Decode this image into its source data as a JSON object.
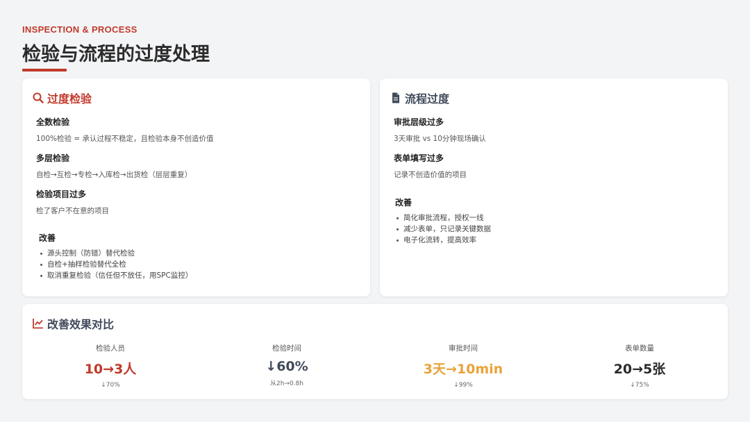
{
  "header": {
    "eyebrow": "INSPECTION & PROCESS",
    "title": "检验与流程的过度处理",
    "accent": "#c0392b"
  },
  "inspection_card": {
    "icon": "search-icon",
    "title": "过度检验",
    "items": [
      {
        "heading": "全数检验",
        "desc": "100%检验 = 承认过程不稳定，且检验本身不创造价值"
      },
      {
        "heading": "多层检验",
        "desc": "自检→互检→专检→入库检→出货检（层层重复）"
      },
      {
        "heading": "检验项目过多",
        "desc": "检了客户不在意的项目"
      }
    ],
    "improve_label": "改善",
    "improvements": [
      "源头控制（防错）替代检验",
      "自检+抽样检验替代全检",
      "取消重复检验（信任但不放任，用SPC监控）"
    ]
  },
  "process_card": {
    "icon": "document-icon",
    "title": "流程过度",
    "items": [
      {
        "heading": "审批层级过多",
        "desc": "3天审批 vs 10分钟现场确认"
      },
      {
        "heading": "表单填写过多",
        "desc": "记录不创造价值的项目"
      }
    ],
    "improve_label": "改善",
    "improvements": [
      "简化审批流程，授权一线",
      "减少表单，只记录关键数据",
      "电子化流转，提高效率"
    ]
  },
  "comparison_card": {
    "icon": "line-chart-icon",
    "title": "改善效果对比",
    "metrics": [
      {
        "label": "检验人员",
        "value": "10→3人",
        "sub": "↓70%",
        "color": "#c0392b"
      },
      {
        "label": "检验时间",
        "value": "↓60%",
        "sub": "从2h→0.8h",
        "color": "#3f4a5a"
      },
      {
        "label": "审批时间",
        "value": "3天→10min",
        "sub": "↓99%",
        "color": "#e8a33a"
      },
      {
        "label": "表单数量",
        "value": "20→5张",
        "sub": "↓75%",
        "color": "#2b2b2b"
      }
    ]
  }
}
